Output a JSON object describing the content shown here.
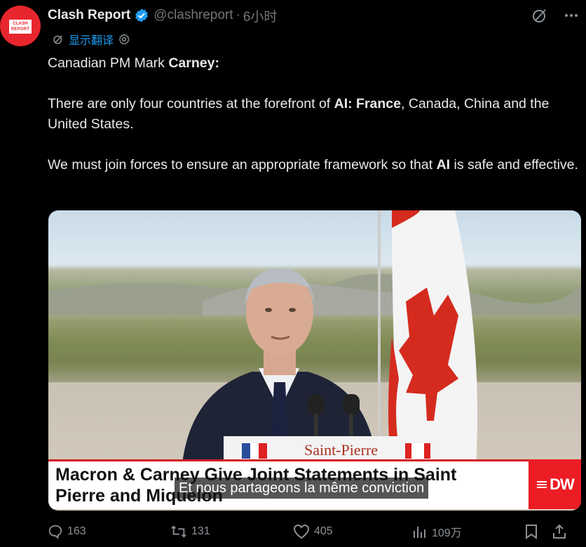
{
  "author": {
    "name": "Clash Report",
    "handle": "@clashreport",
    "time": "6小时",
    "avatar_text": "CLASH REPORT"
  },
  "translate_label": "显示翻译",
  "tweet": {
    "intro_plain": "Canadian PM Mark ",
    "intro_bold": "Carney:",
    "p2_a": "There are only four countries at the forefront of ",
    "p2_b": "AI: France",
    "p2_c": ", Canada, China and the United States.",
    "p3_a": "We must join forces to ensure an appropriate framework so that ",
    "p3_b": "AI",
    "p3_c": " is safe and effective."
  },
  "media": {
    "headline_line1": "Macron & Carney Give Joint Statements in Saint",
    "headline_line2": "Pierre and Miquelon",
    "channel_logo": "DW",
    "subtitle": "Et nous partageons la même conviction",
    "podium_sign": "Saint-Pierre"
  },
  "stats": {
    "replies": "163",
    "reposts": "131",
    "likes": "405",
    "views": "109万"
  },
  "colors": {
    "accent": "#1d9bf0",
    "muted": "#71767b",
    "brand_red": "#e8262d"
  }
}
